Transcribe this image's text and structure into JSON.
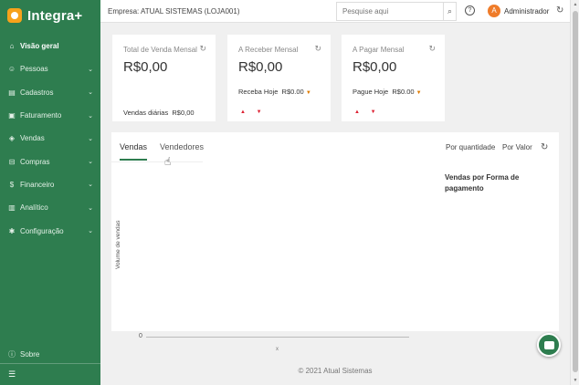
{
  "brand": {
    "name": "Integra+"
  },
  "sidebar": {
    "items": [
      {
        "icon": "home-icon",
        "glyph": "⌂",
        "label": "Visão geral",
        "active": true,
        "chevron": false
      },
      {
        "icon": "people-icon",
        "glyph": "☺",
        "label": "Pessoas",
        "chevron": true
      },
      {
        "icon": "clipboard-icon",
        "glyph": "▤",
        "label": "Cadastros",
        "chevron": true
      },
      {
        "icon": "invoice-icon",
        "glyph": "▣",
        "label": "Faturamento",
        "chevron": true
      },
      {
        "icon": "tag-icon",
        "glyph": "◈",
        "label": "Vendas",
        "chevron": true
      },
      {
        "icon": "cart-icon",
        "glyph": "⊟",
        "label": "Compras",
        "chevron": true
      },
      {
        "icon": "finance-icon",
        "glyph": "$",
        "label": "Financeiro",
        "chevron": true
      },
      {
        "icon": "chart-icon",
        "glyph": "▥",
        "label": "Analítico",
        "chevron": true
      },
      {
        "icon": "gear-icon",
        "glyph": "✱",
        "label": "Configuração",
        "chevron": true
      }
    ],
    "sobre": "Sobre"
  },
  "topbar": {
    "empresa_label": "Empresa:",
    "empresa_value": "ATUAL SISTEMAS (LOJA001)",
    "search_placeholder": "Pesquise aqui",
    "avatar_letter": "A",
    "user_name": "Administrador"
  },
  "cards": [
    {
      "title": "Total de Venda Mensal",
      "value": "R$0,00",
      "sub_label": "Vendas diárias",
      "sub_value": "R$0,00"
    },
    {
      "title": "A Receber Mensal",
      "value": "R$0,00",
      "sub_label": "Receba Hoje",
      "sub_value": "R$0.00"
    },
    {
      "title": "A Pagar Mensal",
      "value": "R$0,00",
      "sub_label": "Pague Hoje",
      "sub_value": "R$0.00"
    }
  ],
  "panel": {
    "tabs": [
      "Vendas",
      "Vendedores"
    ],
    "toggle_quantity": "Por quantidade",
    "toggle_value": "Por Valor",
    "payment_title": "Vendas por Forma de pagamento"
  },
  "chart_data": {
    "type": "bar",
    "title": "",
    "xlabel": "",
    "ylabel": "Volume de vendas",
    "y_ticks": [
      "0"
    ],
    "x_ticks": [
      "x"
    ],
    "series": []
  },
  "footer": {
    "text": "© 2021 Atual Sistemas"
  },
  "colors": {
    "sidebar": "#2e7d4f",
    "accent": "#f7a21b",
    "avatar": "#ef7c2a"
  }
}
